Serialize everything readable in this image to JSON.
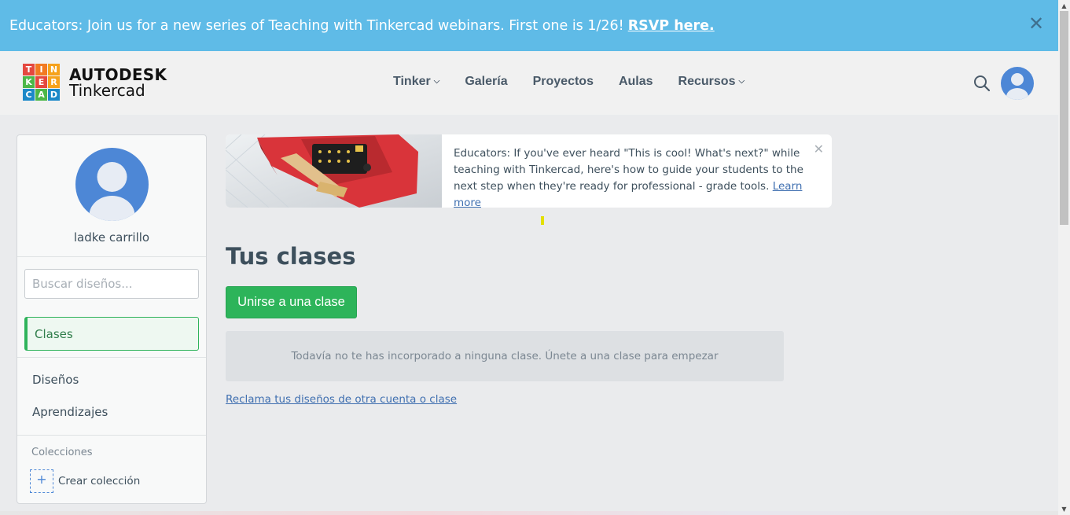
{
  "announcement": {
    "text": "Educators: Join us for a new series of Teaching with Tinkercad webinars. First one is 1/26!",
    "link": "RSVP here.",
    "close": "✕"
  },
  "header": {
    "logo_letters": [
      "T",
      "I",
      "N",
      "K",
      "E",
      "R",
      "C",
      "A",
      "D"
    ],
    "logo_colors": [
      "#e5483f",
      "#f27a22",
      "#f6a21c",
      "#4cb748",
      "#e5483f",
      "#f6a21c",
      "#1c89c8",
      "#4cb748",
      "#1c89c8"
    ],
    "brand": "AUTODESK",
    "product": "Tinkercad",
    "nav": [
      {
        "label": "Tinker",
        "has_dropdown": true
      },
      {
        "label": "Galería",
        "has_dropdown": false
      },
      {
        "label": "Proyectos",
        "has_dropdown": false
      },
      {
        "label": "Aulas",
        "has_dropdown": false
      },
      {
        "label": "Recursos",
        "has_dropdown": true
      }
    ],
    "search_icon": "search-icon",
    "avatar_icon": "user-avatar-icon"
  },
  "sidebar": {
    "username": "ladke carrillo",
    "search_placeholder": "Buscar diseños...",
    "active_item": "Clases",
    "items": [
      "Diseños",
      "Aprendizajes"
    ],
    "collections_label": "Colecciones",
    "create_collection_plus": "+",
    "create_collection": "Crear colección"
  },
  "promo": {
    "text": "Educators: If you've ever heard \"This is cool! What's next?\" while teaching with Tinkercad, here's how to guide your students to the next step when they're ready for professional - grade tools.",
    "link": "Learn more",
    "close": "✕"
  },
  "main": {
    "title": "Tus clases",
    "join_button": "Unirse a una clase",
    "empty_message": "Todavía no te has incorporado a ninguna clase. Únete a una clase para empezar",
    "claim_link": "Reclama tus diseños de otra cuenta o clase"
  },
  "colors": {
    "banner": "#5fbbe7",
    "accent_green": "#2db45a",
    "avatar_blue": "#4d87d6",
    "link_blue": "#3f6fb0"
  }
}
